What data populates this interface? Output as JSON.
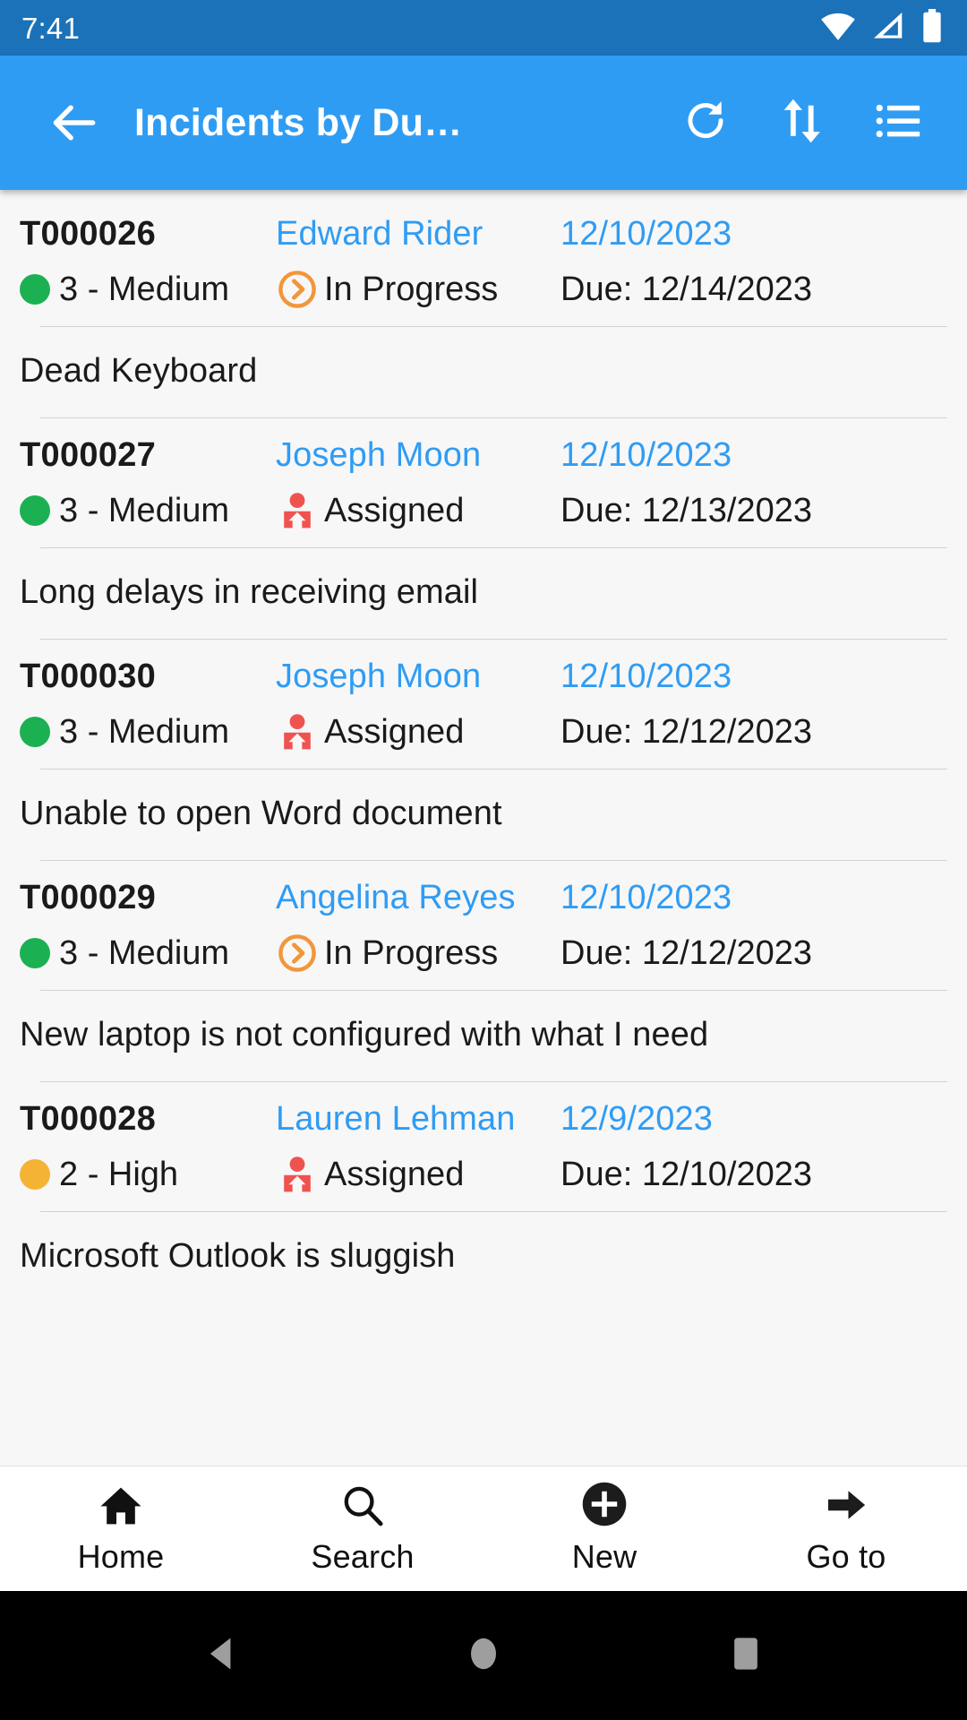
{
  "status_bar": {
    "time": "7:41",
    "icons": [
      "wifi-icon",
      "cellular-signal-icon",
      "battery-icon"
    ],
    "background": "#1b72b8"
  },
  "app_bar": {
    "back_label": "back-arrow",
    "title": "Incidents by Du…",
    "background": "#2f9cf4",
    "actions": [
      {
        "name": "refresh",
        "icon": "refresh-icon"
      },
      {
        "name": "sort",
        "icon": "sort-arrows-icon"
      },
      {
        "name": "menu",
        "icon": "list-menu-icon"
      }
    ]
  },
  "colors": {
    "accent_blue": "#2f9cf4",
    "priority_medium": "#1bb152",
    "priority_high": "#f5b335",
    "status_inprogress": "#f2963c",
    "status_assigned": "#ef5350",
    "text_primary": "#1a1a1a",
    "separator": "#d2d2d2",
    "list_background": "#f7f7f7"
  },
  "list": {
    "items": [
      {
        "ticket_id": "T000026",
        "assignee": "Edward Rider",
        "created_date": "12/10/2023",
        "priority_label": "3 - Medium",
        "priority_color": "#1bb152",
        "status_label": "In Progress",
        "status_icon": "in-progress-icon",
        "due_label": "Due: 12/14/2023",
        "description": "Dead Keyboard"
      },
      {
        "ticket_id": "T000027",
        "assignee": "Joseph Moon",
        "created_date": "12/10/2023",
        "priority_label": "3 - Medium",
        "priority_color": "#1bb152",
        "status_label": "Assigned",
        "status_icon": "assigned-person-icon",
        "due_label": "Due: 12/13/2023",
        "description": "Long delays in receiving email"
      },
      {
        "ticket_id": "T000030",
        "assignee": "Joseph Moon",
        "created_date": "12/10/2023",
        "priority_label": "3 - Medium",
        "priority_color": "#1bb152",
        "status_label": "Assigned",
        "status_icon": "assigned-person-icon",
        "due_label": "Due: 12/12/2023",
        "description": "Unable to open Word document"
      },
      {
        "ticket_id": "T000029",
        "assignee": "Angelina Reyes",
        "created_date": "12/10/2023",
        "priority_label": "3 - Medium",
        "priority_color": "#1bb152",
        "status_label": "In Progress",
        "status_icon": "in-progress-icon",
        "due_label": "Due: 12/12/2023",
        "description": "New laptop is not configured with what I need"
      },
      {
        "ticket_id": "T000028",
        "assignee": "Lauren Lehman",
        "created_date": "12/9/2023",
        "priority_label": "2 - High",
        "priority_color": "#f5b335",
        "status_label": "Assigned",
        "status_icon": "assigned-person-icon",
        "due_label": "Due: 12/10/2023",
        "description": "Microsoft Outlook is sluggish"
      }
    ]
  },
  "bottom_nav": {
    "items": [
      {
        "label": "Home",
        "icon": "home-icon"
      },
      {
        "label": "Search",
        "icon": "search-icon"
      },
      {
        "label": "New",
        "icon": "plus-circle-icon"
      },
      {
        "label": "Go to",
        "icon": "arrow-right-icon"
      }
    ]
  },
  "system_nav": {
    "items": [
      {
        "name": "back",
        "icon": "triangle-back-icon"
      },
      {
        "name": "home",
        "icon": "circle-home-icon"
      },
      {
        "name": "recents",
        "icon": "square-recents-icon"
      }
    ]
  }
}
